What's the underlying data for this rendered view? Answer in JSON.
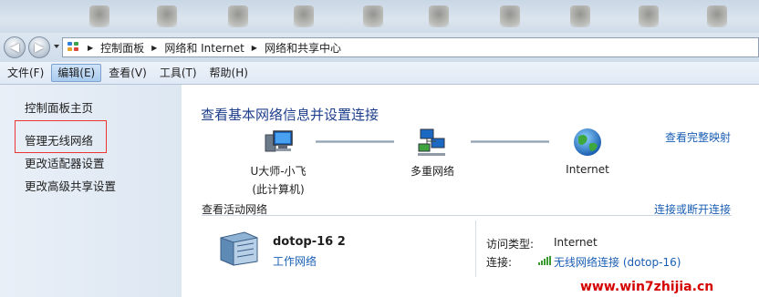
{
  "address_bar": {
    "breadcrumbs": [
      "控制面板",
      "网络和 Internet",
      "网络和共享中心"
    ]
  },
  "menu": {
    "items": [
      {
        "label": "文件(F)",
        "active": false
      },
      {
        "label": "编辑(E)",
        "active": true
      },
      {
        "label": "查看(V)",
        "active": false
      },
      {
        "label": "工具(T)",
        "active": false
      },
      {
        "label": "帮助(H)",
        "active": false
      }
    ]
  },
  "sidebar": {
    "items": [
      {
        "label": "控制面板主页"
      },
      {
        "label": "管理无线网络"
      },
      {
        "label": "更改适配器设置"
      },
      {
        "label": "更改高级共享设置"
      }
    ]
  },
  "main": {
    "title": "查看基本网络信息并设置连接",
    "full_map_link": "查看完整映射",
    "map": {
      "computer_line1": "U大师-小飞",
      "computer_line2": "(此计算机)",
      "network_label": "多重网络",
      "internet_label": "Internet"
    },
    "active_networks_label": "查看活动网络",
    "connect_link": "连接或断开连接",
    "network": {
      "name": "dotop-16  2",
      "type_link": "工作网络",
      "access_type_label": "访问类型:",
      "access_type_value": "Internet",
      "connection_label": "连接:",
      "connection_value": "无线网络连接 (dotop-16)"
    }
  },
  "watermark": "www.win7zhijia.cn",
  "colors": {
    "title_blue": "#1e3e8c",
    "link_blue": "#1a5fb4",
    "highlight_box": "#e33333",
    "watermark_red": "#d40000"
  }
}
